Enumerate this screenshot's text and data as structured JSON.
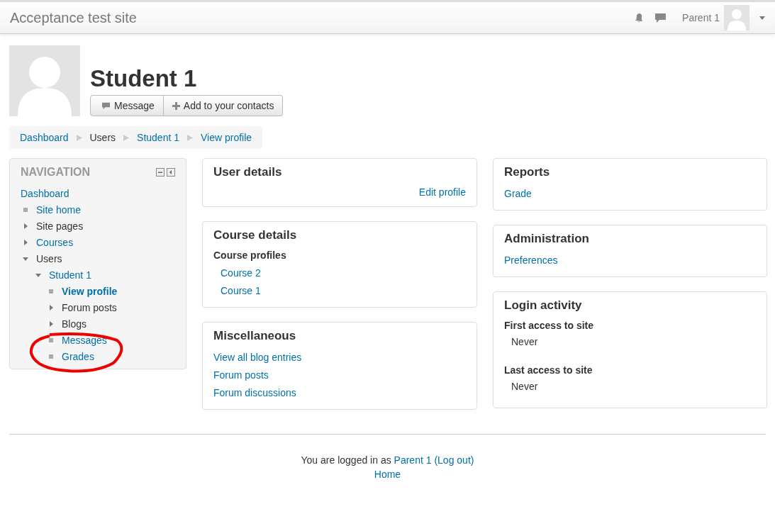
{
  "header": {
    "site_name": "Acceptance test site",
    "user_name": "Parent 1"
  },
  "profile": {
    "name": "Student 1",
    "buttons": [
      {
        "kind": "message",
        "label": "Message"
      },
      {
        "kind": "add",
        "label": "Add to your contacts"
      }
    ]
  },
  "breadcrumb": [
    {
      "label": "Dashboard",
      "link": true
    },
    {
      "label": "Users",
      "link": false
    },
    {
      "label": "Student 1",
      "link": true
    },
    {
      "label": "View profile",
      "link": true
    }
  ],
  "navigation": {
    "title": "NAVIGATION",
    "items": [
      {
        "kind": "root",
        "label": "Dashboard",
        "link": true,
        "current": false,
        "children": [
          {
            "kind": "leaf",
            "label": "Site home",
            "link": true,
            "current": false
          },
          {
            "kind": "branch",
            "label": "Site pages",
            "link": false,
            "current": false,
            "expanded": false
          },
          {
            "kind": "branch",
            "label": "Courses",
            "link": true,
            "current": false,
            "expanded": false
          },
          {
            "kind": "branch",
            "label": "Users",
            "link": false,
            "current": false,
            "expanded": true,
            "children": [
              {
                "kind": "branch",
                "label": "Student 1",
                "link": true,
                "current": false,
                "expanded": true,
                "children": [
                  {
                    "kind": "leaf",
                    "label": "View profile",
                    "link": true,
                    "current": true
                  },
                  {
                    "kind": "branch",
                    "label": "Forum posts",
                    "link": false,
                    "current": false,
                    "expanded": false
                  },
                  {
                    "kind": "branch",
                    "label": "Blogs",
                    "link": false,
                    "current": false,
                    "expanded": false
                  },
                  {
                    "kind": "leaf",
                    "label": "Messages",
                    "link": true,
                    "current": false
                  },
                  {
                    "kind": "leaf",
                    "label": "Grades",
                    "link": true,
                    "current": false
                  }
                ]
              }
            ]
          }
        ]
      }
    ]
  },
  "columns": [
    [
      {
        "title": "User details",
        "sections": [
          {
            "kind": "link-right",
            "text": "Edit profile"
          }
        ]
      },
      {
        "title": "Course details",
        "sections": [
          {
            "kind": "subheading",
            "text": "Course profiles"
          },
          {
            "kind": "indented-link",
            "text": "Course 2"
          },
          {
            "kind": "indented-link",
            "text": "Course 1"
          }
        ]
      },
      {
        "title": "Miscellaneous",
        "sections": [
          {
            "kind": "link",
            "text": "View all blog entries"
          },
          {
            "kind": "link",
            "text": "Forum posts"
          },
          {
            "kind": "link",
            "text": "Forum discussions"
          }
        ]
      }
    ],
    [
      {
        "title": "Reports",
        "sections": [
          {
            "kind": "link",
            "text": "Grade"
          }
        ]
      },
      {
        "title": "Administration",
        "sections": [
          {
            "kind": "link",
            "text": "Preferences"
          }
        ]
      },
      {
        "title": "Login activity",
        "sections": [
          {
            "kind": "field",
            "label": "First access to site",
            "value": "Never"
          },
          {
            "kind": "field",
            "label": "Last access to site",
            "value": "Never"
          }
        ]
      }
    ]
  ],
  "footer": {
    "logged_in_text": "You are logged in as",
    "user_link": "Parent 1",
    "logout_link": "(Log out)",
    "home_link": "Home"
  }
}
